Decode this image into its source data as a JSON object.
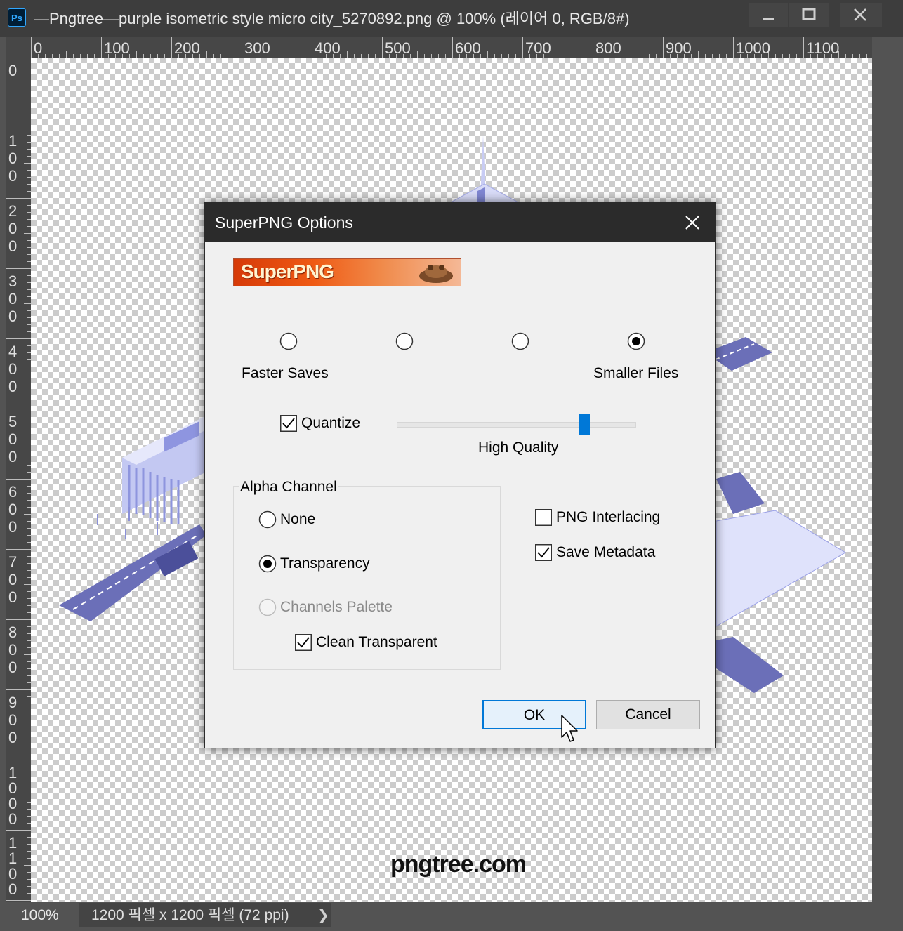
{
  "window": {
    "app_icon": "Ps",
    "title": "—Pngtree—purple isometric style micro city_5270892.png @ 100% (레이어 0, RGB/8#)",
    "controls": [
      "minimize-icon",
      "maximize-icon",
      "close-icon"
    ]
  },
  "rulers": {
    "top_labels": [
      "0",
      "100",
      "200",
      "300",
      "400",
      "500",
      "600",
      "700",
      "800",
      "900",
      "1000",
      "1100"
    ],
    "left_labels": [
      "0",
      "100",
      "200",
      "300",
      "400",
      "500",
      "600",
      "700",
      "800",
      "900",
      "1000",
      "1100"
    ]
  },
  "canvas": {
    "watermark": "pngtree.com"
  },
  "statusbar": {
    "zoom": "100%",
    "doc_info": "1200 픽셀 x 1200 픽셀 (72 ppi)",
    "arrow": "❯"
  },
  "dialog": {
    "title": "SuperPNG Options",
    "banner_text": "SuperPNG",
    "compression": {
      "left_label": "Faster Saves",
      "right_label": "Smaller Files",
      "levels": 4,
      "selected_index": 3
    },
    "quantize": {
      "label": "Quantize",
      "checked": true,
      "slider_label": "High Quality",
      "slider_value": 0.78
    },
    "alpha": {
      "group_label": "Alpha Channel",
      "options": [
        {
          "label": "None",
          "selected": false,
          "disabled": false
        },
        {
          "label": "Transparency",
          "selected": true,
          "disabled": false
        },
        {
          "label": "Channels Palette",
          "selected": false,
          "disabled": true
        }
      ],
      "clean_transparent": {
        "label": "Clean Transparent",
        "checked": true
      }
    },
    "png_interlacing": {
      "label": "PNG Interlacing",
      "checked": false
    },
    "save_metadata": {
      "label": "Save Metadata",
      "checked": true
    },
    "ok_label": "OK",
    "cancel_label": "Cancel"
  },
  "colors": {
    "accent": "#0078d7",
    "titlebar": "#3d3d3d",
    "dialog_header": "#2b2b2b",
    "road": "#6b6fb8",
    "building": "#aeb4ec"
  }
}
